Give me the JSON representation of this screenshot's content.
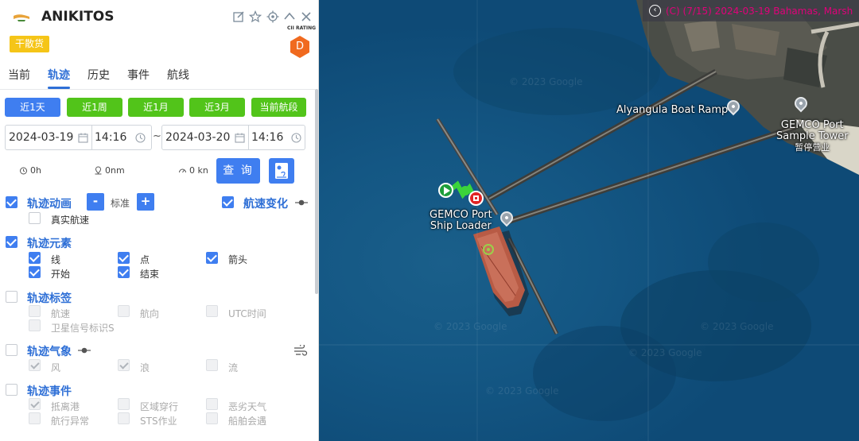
{
  "header": {
    "ship_name": "ANIKITOS",
    "type_badge": "干散货",
    "cii_label": "CII RATING",
    "cii_grade": "D",
    "icons": [
      "edit-icon",
      "star-icon",
      "locate-icon",
      "collapse-icon",
      "close-icon"
    ]
  },
  "tabs": [
    {
      "label": "当前"
    },
    {
      "label": "轨迹",
      "active": true
    },
    {
      "label": "历史"
    },
    {
      "label": "事件"
    },
    {
      "label": "航线"
    }
  ],
  "range_buttons": [
    {
      "label": "近1天",
      "color": "#3f7ef0",
      "selected": true
    },
    {
      "label": "近1周",
      "color": "#52c41a"
    },
    {
      "label": "近1月",
      "color": "#52c41a"
    },
    {
      "label": "近3月",
      "color": "#52c41a"
    },
    {
      "label": "当前航段",
      "color": "#52c41a"
    }
  ],
  "date_range": {
    "start_date": "2024-03-19",
    "start_time": "14:16",
    "separator": "~",
    "end_date": "2024-03-20",
    "end_time": "14:16"
  },
  "stats": {
    "duration": "0h",
    "distance": "0nm",
    "speed": "0 kn"
  },
  "query_label": "查 询",
  "sections": {
    "animation": {
      "title": "轨迹动画",
      "checked": true,
      "speed_minus": "-",
      "speed_label": "标准",
      "speed_plus": "+",
      "real_speed_label": "真实航速",
      "speed_change_title": "航速变化"
    },
    "elements": {
      "title": "轨迹元素",
      "items": [
        {
          "label": "线"
        },
        {
          "label": "点"
        },
        {
          "label": "箭头"
        },
        {
          "label": "开始"
        },
        {
          "label": "结束"
        }
      ]
    },
    "labels": {
      "title": "轨迹标签",
      "items": [
        {
          "label": "航速"
        },
        {
          "label": "航向"
        },
        {
          "label": "UTC时间"
        },
        {
          "label": "卫星信号标识S"
        }
      ]
    },
    "weather": {
      "title": "轨迹气象",
      "items": [
        {
          "label": "风"
        },
        {
          "label": "浪"
        },
        {
          "label": "流"
        }
      ]
    },
    "events": {
      "title": "轨迹事件",
      "items": [
        {
          "label": "抵离港"
        },
        {
          "label": "区域穿行"
        },
        {
          "label": "恶劣天气"
        },
        {
          "label": "航行异常"
        },
        {
          "label": "STS作业"
        },
        {
          "label": "船舶会遇"
        }
      ]
    }
  },
  "map": {
    "top_bar_text": "(C) (7/15) 2024-03-19 Bahamas, Marsh",
    "labels": {
      "boat_ramp": "Alyangula Boat Ramp",
      "sample_tower_1": "GEMCO Port",
      "sample_tower_2": "Sample Tower",
      "sample_tower_3": "暂停营业",
      "ship_loader_1": "GEMCO Port",
      "ship_loader_2": "Ship Loader"
    },
    "watermark": "© 2023 Google"
  }
}
